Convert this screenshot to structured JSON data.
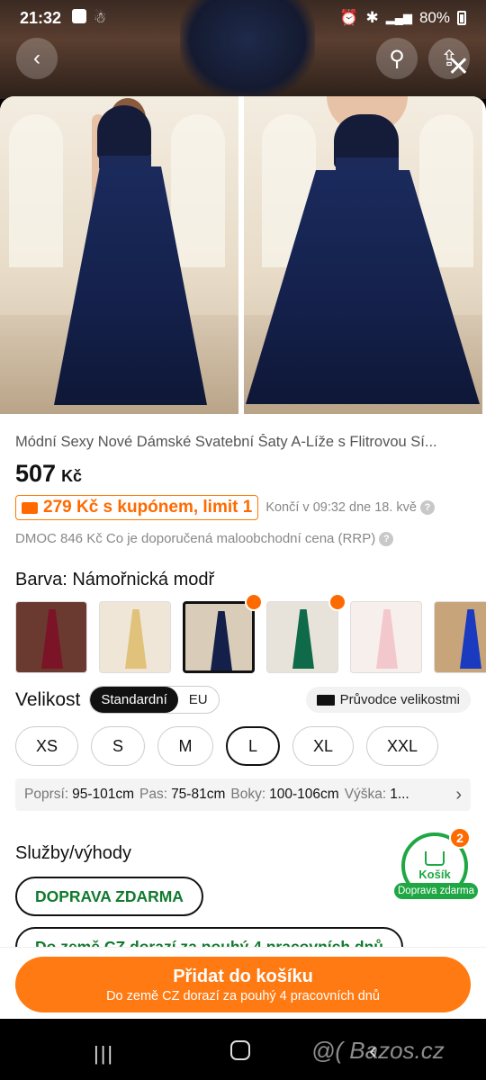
{
  "status": {
    "time": "21:32",
    "battery": "80%"
  },
  "product": {
    "title": "Módní Sexy Nové Dámské Svatební Šaty A-Líže s Flitrovou Sí...",
    "price": "507",
    "currency": "Kč",
    "coupon": "279 Kč s kupónem, limit 1",
    "expires": "Končí v 09:32 dne 18. kvě",
    "rrp": "DMOC 846 Kč Co je doporučená maloobchodní cena (RRP)"
  },
  "color": {
    "label": "Barva: Námořnická modř",
    "swatches": [
      {
        "name": "burgundy",
        "color": "#7a1426",
        "bg": "#6a3a30"
      },
      {
        "name": "champagne",
        "color": "#e0c27a",
        "bg": "#efe6d8"
      },
      {
        "name": "navy",
        "color": "#14204a",
        "bg": "#d9ccb8"
      },
      {
        "name": "green",
        "color": "#0f6a4a",
        "bg": "#e8e3da"
      },
      {
        "name": "pink",
        "color": "#f3c8cc",
        "bg": "#f7efec"
      },
      {
        "name": "royal-blue",
        "color": "#1a3ac0",
        "bg": "#c8a47a"
      }
    ]
  },
  "size": {
    "label": "Velikost",
    "standard": "Standardní",
    "eu": "EU",
    "guide": "Průvodce velikostmi",
    "options": [
      "XS",
      "S",
      "M",
      "L",
      "XL",
      "XXL"
    ],
    "selected": "L",
    "measure": {
      "bust_k": "Poprsí:",
      "bust_v": "95-101cm",
      "waist_k": "Pas:",
      "waist_v": "75-81cm",
      "hips_k": "Boky:",
      "hips_v": "100-106cm",
      "height_k": "Výška:",
      "height_v": "1..."
    }
  },
  "services": {
    "label": "Služby/výhody",
    "free_shipping": "DOPRAVA ZDARMA",
    "delivery": "Do země CZ dorazí za pouhý 4 pracovních dnů"
  },
  "cart": {
    "label": "Košík",
    "count": "2",
    "free": "Doprava zdarma"
  },
  "add_to_cart": {
    "main": "Přidat do košíku",
    "sub": "Do země CZ dorazí za pouhý 4 pracovních dnů"
  },
  "watermark": "@( Bazos.cz"
}
